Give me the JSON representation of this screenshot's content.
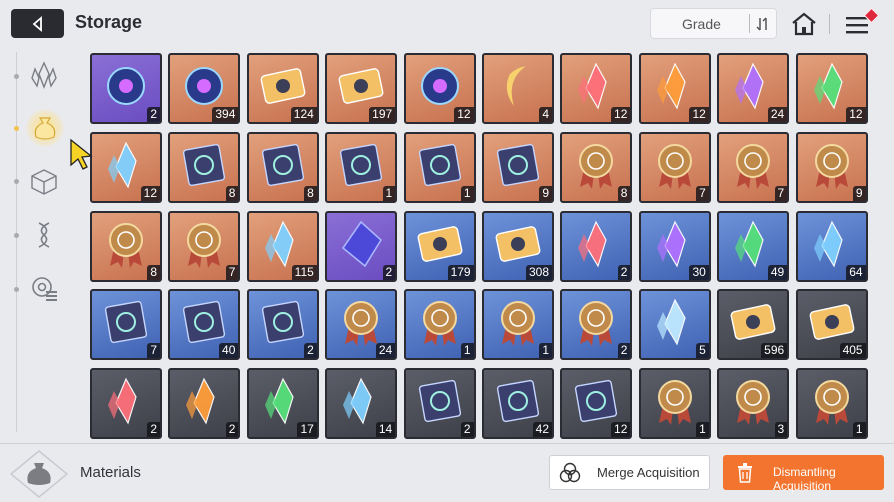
{
  "header": {
    "title": "Storage",
    "sort_label": "Grade",
    "icons": {
      "back": "back-arrow-icon",
      "sort": "sort-order-icon",
      "home": "home-icon",
      "menu": "menu-icon"
    }
  },
  "sidebar": {
    "categories": [
      {
        "icon": "crystal-icon",
        "active": false
      },
      {
        "icon": "material-bag-icon",
        "active": true
      },
      {
        "icon": "cube-icon",
        "active": false
      },
      {
        "icon": "dna-icon",
        "active": false
      },
      {
        "icon": "gear-list-icon",
        "active": false
      }
    ]
  },
  "colors": {
    "purple": "#6a4cc0",
    "orange": "#c7714f",
    "blue": "#3f61b2",
    "gray": "#3e4049",
    "accent": "#f2742e"
  },
  "items": [
    {
      "rarity": "purple",
      "icon": "eye-card-icon",
      "count": "2"
    },
    {
      "rarity": "orange",
      "icon": "blue-orb-icon",
      "count": "394"
    },
    {
      "rarity": "orange",
      "icon": "orange-ticket-icon",
      "count": "124"
    },
    {
      "rarity": "orange",
      "icon": "gold-ticket-icon",
      "count": "197"
    },
    {
      "rarity": "orange",
      "icon": "dark-eye-icon",
      "count": "12"
    },
    {
      "rarity": "orange",
      "icon": "gold-moon-icon",
      "count": "4"
    },
    {
      "rarity": "orange",
      "icon": "red-crystal-icon",
      "count": "12"
    },
    {
      "rarity": "orange",
      "icon": "orange-crystal-icon",
      "count": "12"
    },
    {
      "rarity": "orange",
      "icon": "purple-crystal-icon",
      "count": "24"
    },
    {
      "rarity": "orange",
      "icon": "green-crystal-icon",
      "count": "12"
    },
    {
      "rarity": "orange",
      "icon": "blue-crystal-icon",
      "count": "12"
    },
    {
      "rarity": "orange",
      "icon": "sword-book-icon",
      "count": "8"
    },
    {
      "rarity": "orange",
      "icon": "shield-book-icon",
      "count": "8"
    },
    {
      "rarity": "orange",
      "icon": "eye-book-icon",
      "count": "1"
    },
    {
      "rarity": "orange",
      "icon": "wing-book-icon",
      "count": "1"
    },
    {
      "rarity": "orange",
      "icon": "star-book-icon",
      "count": "9"
    },
    {
      "rarity": "orange",
      "icon": "sword-medal-icon",
      "count": "8"
    },
    {
      "rarity": "orange",
      "icon": "shield-medal-icon",
      "count": "7"
    },
    {
      "rarity": "orange",
      "icon": "square-medal-icon",
      "count": "7"
    },
    {
      "rarity": "orange",
      "icon": "cross-medal-icon",
      "count": "9"
    },
    {
      "rarity": "orange",
      "icon": "star-medal-icon",
      "count": "8"
    },
    {
      "rarity": "orange",
      "icon": "target-medal-icon",
      "count": "7"
    },
    {
      "rarity": "orange",
      "icon": "leaf-shards-icon",
      "count": "115"
    },
    {
      "rarity": "purple",
      "icon": "violet-gem-icon",
      "count": "2"
    },
    {
      "rarity": "blue",
      "icon": "blue-ticket-icon",
      "count": "179"
    },
    {
      "rarity": "blue",
      "icon": "silver-ticket-icon",
      "count": "308"
    },
    {
      "rarity": "blue",
      "icon": "red-shard-icon",
      "count": "2"
    },
    {
      "rarity": "blue",
      "icon": "purple-shard-icon",
      "count": "30"
    },
    {
      "rarity": "blue",
      "icon": "green-shard-icon",
      "count": "49"
    },
    {
      "rarity": "blue",
      "icon": "blue-shard-icon",
      "count": "64"
    },
    {
      "rarity": "blue",
      "icon": "shield-tome-icon",
      "count": "7"
    },
    {
      "rarity": "blue",
      "icon": "eye-tome-icon",
      "count": "40"
    },
    {
      "rarity": "blue",
      "icon": "wing-tome-icon",
      "count": "2"
    },
    {
      "rarity": "blue",
      "icon": "shield-badge-icon",
      "count": "24"
    },
    {
      "rarity": "blue",
      "icon": "target-badge-icon",
      "count": "1"
    },
    {
      "rarity": "blue",
      "icon": "star-badge-icon",
      "count": "1"
    },
    {
      "rarity": "blue",
      "icon": "sword-badge-icon",
      "count": "2"
    },
    {
      "rarity": "blue",
      "icon": "ice-crystal-icon",
      "count": "5"
    },
    {
      "rarity": "gray",
      "icon": "gray-ticket-icon",
      "count": "596"
    },
    {
      "rarity": "gray",
      "icon": "gray-compass-ticket-icon",
      "count": "405"
    },
    {
      "rarity": "gray",
      "icon": "pink-stone-icon",
      "count": "2"
    },
    {
      "rarity": "gray",
      "icon": "orange-stone-icon",
      "count": "2"
    },
    {
      "rarity": "gray",
      "icon": "green-stone-icon",
      "count": "17"
    },
    {
      "rarity": "gray",
      "icon": "blue-stone-icon",
      "count": "14"
    },
    {
      "rarity": "gray",
      "icon": "shield-scroll-icon",
      "count": "2"
    },
    {
      "rarity": "gray",
      "icon": "star-scroll-icon",
      "count": "42"
    },
    {
      "rarity": "gray",
      "icon": "target-scroll-icon",
      "count": "12"
    },
    {
      "rarity": "gray",
      "icon": "sword-ribbon-icon",
      "count": "1"
    },
    {
      "rarity": "gray",
      "icon": "shield-ribbon-icon",
      "count": "3"
    },
    {
      "rarity": "gray",
      "icon": "wing-ribbon-icon",
      "count": "1"
    }
  ],
  "footer": {
    "category_label": "Materials",
    "merge_label": "Merge Acquisition",
    "dismantle_label": "Dismantling Acquisition"
  }
}
